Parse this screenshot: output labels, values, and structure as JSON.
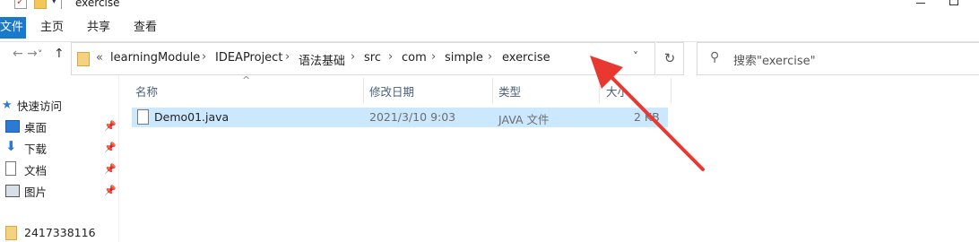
{
  "window": {
    "title": "exercise"
  },
  "ribbon": {
    "tabs": [
      "文件",
      "主页",
      "共享",
      "查看"
    ]
  },
  "nav": {
    "back": "←",
    "forward": "→",
    "recent": "˅",
    "up": "↑"
  },
  "address": {
    "overflow": "«",
    "crumbs": [
      "learningModule",
      "IDEAProject",
      "语法基础",
      "src",
      "com",
      "simple",
      "exercise"
    ],
    "dropdown": "˅",
    "refresh": "↻"
  },
  "search": {
    "placeholder": "搜索\"exercise\"",
    "icon": "⚲"
  },
  "sidebar": {
    "quick_access": "快速访问",
    "items": [
      {
        "label": "桌面",
        "icon": "desktop-icon"
      },
      {
        "label": "下载",
        "icon": "download-icon"
      },
      {
        "label": "文档",
        "icon": "document-icon"
      },
      {
        "label": "图片",
        "icon": "pictures-icon"
      }
    ],
    "folder": "2417338116",
    "pin": "📌"
  },
  "columns": {
    "name": "名称",
    "modified": "修改日期",
    "type": "类型",
    "size": "大小",
    "sort_indicator": "^"
  },
  "files": [
    {
      "name": "Demo01.java",
      "modified": "2021/3/10 9:03",
      "type": "JAVA 文件",
      "size": "2 KB"
    }
  ],
  "colors": {
    "accent": "#1979ca",
    "selection": "#cce8ff",
    "arrow": "#e8382f"
  }
}
